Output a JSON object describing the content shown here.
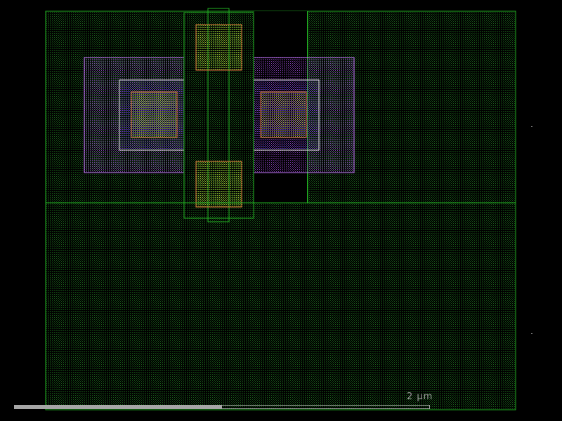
{
  "viewer": {
    "background_color": "#000000",
    "scale": {
      "label": "2 μm",
      "fill_fraction": 0.5
    },
    "colors": {
      "green": "#22b022",
      "orange": "#d8743a",
      "magenta": "#c878ff",
      "white": "#e6e6e6",
      "grey": "#a6a6a6",
      "gate_fill_yellowgreen": "#7f8f30",
      "overlap_blue": "#3b3bc0"
    }
  }
}
